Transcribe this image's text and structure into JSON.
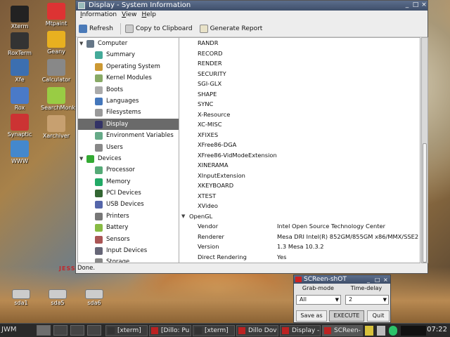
{
  "colors": {
    "selection": "#6a6a6a",
    "titlebar": "#3e4e6a",
    "taskbar": "#2a2a2a"
  },
  "desktop": {
    "icons": [
      {
        "label": "Xterm",
        "icon": "terminal-icon"
      },
      {
        "label": "Mtpaint",
        "icon": "paint-icon"
      },
      {
        "label": "RoxTerm",
        "icon": "terminal-icon"
      },
      {
        "label": "Geany",
        "icon": "editor-icon"
      },
      {
        "label": "Xfe",
        "icon": "file-manager-icon"
      },
      {
        "label": "Calculator",
        "icon": "calculator-icon"
      },
      {
        "label": "Rox",
        "icon": "file-manager-icon"
      },
      {
        "label": "SearchMonkey",
        "icon": "search-icon"
      },
      {
        "label": "Synaptic",
        "icon": "package-icon"
      },
      {
        "label": "Xarchiver",
        "icon": "archive-icon"
      },
      {
        "label": "WWW",
        "icon": "browser-icon"
      }
    ],
    "drives": [
      "sda1",
      "sda5",
      "sda6"
    ],
    "wallpaper_text": "JESSI"
  },
  "window": {
    "title": "Display - System Information",
    "menu": [
      "Information",
      "View",
      "Help"
    ],
    "toolbar": {
      "refresh": "Refresh",
      "copy": "Copy to Clipboard",
      "report": "Generate Report"
    },
    "status": "Done."
  },
  "tree": [
    {
      "label": "Computer",
      "icon": "computer-icon",
      "level": 0,
      "expander": "▼"
    },
    {
      "label": "Summary",
      "icon": "summary-icon",
      "level": 1
    },
    {
      "label": "Operating System",
      "icon": "os-icon",
      "level": 1
    },
    {
      "label": "Kernel Modules",
      "icon": "module-icon",
      "level": 1
    },
    {
      "label": "Boots",
      "icon": "boot-icon",
      "level": 1
    },
    {
      "label": "Languages",
      "icon": "language-icon",
      "level": 1
    },
    {
      "label": "Filesystems",
      "icon": "filesystem-icon",
      "level": 1
    },
    {
      "label": "Display",
      "icon": "display-icon",
      "level": 1,
      "selected": true
    },
    {
      "label": "Environment Variables",
      "icon": "env-icon",
      "level": 1
    },
    {
      "label": "Users",
      "icon": "users-icon",
      "level": 1
    },
    {
      "label": "Devices",
      "icon": "devices-icon",
      "level": 0,
      "expander": "▼"
    },
    {
      "label": "Processor",
      "icon": "processor-icon",
      "level": 1
    },
    {
      "label": "Memory",
      "icon": "memory-icon",
      "level": 1
    },
    {
      "label": "PCI Devices",
      "icon": "pci-icon",
      "level": 1
    },
    {
      "label": "USB Devices",
      "icon": "usb-icon",
      "level": 1
    },
    {
      "label": "Printers",
      "icon": "printer-icon",
      "level": 1
    },
    {
      "label": "Battery",
      "icon": "battery-icon",
      "level": 1
    },
    {
      "label": "Sensors",
      "icon": "sensor-icon",
      "level": 1
    },
    {
      "label": "Input Devices",
      "icon": "input-icon",
      "level": 1
    },
    {
      "label": "Storage",
      "icon": "storage-icon",
      "level": 1
    }
  ],
  "details": [
    {
      "key": "RANDR",
      "value": ""
    },
    {
      "key": "RECORD",
      "value": ""
    },
    {
      "key": "RENDER",
      "value": ""
    },
    {
      "key": "SECURITY",
      "value": ""
    },
    {
      "key": "SGI-GLX",
      "value": ""
    },
    {
      "key": "SHAPE",
      "value": ""
    },
    {
      "key": "SYNC",
      "value": ""
    },
    {
      "key": "X-Resource",
      "value": ""
    },
    {
      "key": "XC-MISC",
      "value": ""
    },
    {
      "key": "XFIXES",
      "value": ""
    },
    {
      "key": "XFree86-DGA",
      "value": ""
    },
    {
      "key": "XFree86-VidModeExtension",
      "value": ""
    },
    {
      "key": "XINERAMA",
      "value": ""
    },
    {
      "key": "XInputExtension",
      "value": ""
    },
    {
      "key": "XKEYBOARD",
      "value": ""
    },
    {
      "key": "XTEST",
      "value": ""
    },
    {
      "key": "XVideo",
      "value": ""
    },
    {
      "key": "OpenGL",
      "value": "",
      "section": true
    },
    {
      "key": "Vendor",
      "value": "Intel Open Source Technology Center"
    },
    {
      "key": "Renderer",
      "value": "Mesa DRI Intel(R) 852GM/855GM x86/MMX/SSE2"
    },
    {
      "key": "Version",
      "value": "1.3 Mesa 10.3.2"
    },
    {
      "key": "Direct Rendering",
      "value": "Yes"
    }
  ],
  "screenshot_dialog": {
    "title": "SCReen-shOT",
    "grab_mode_label": "Grab-mode",
    "delay_label": "Time-delay",
    "grab_mode_value": "All",
    "delay_value": "2",
    "save_label": "Save as",
    "execute_label": "EXECUTE",
    "quit_label": "Quit"
  },
  "taskbar": {
    "start": "JWM",
    "tasks": [
      {
        "label": "[xterm]",
        "icon": "terminal-icon"
      },
      {
        "label": "[Dillo: Pu",
        "icon": "dillo-icon"
      },
      {
        "label": "[xterm]",
        "icon": "terminal-icon"
      },
      {
        "label": "Dillo Dov",
        "icon": "dillo-icon"
      },
      {
        "label": "Display -",
        "icon": "display-icon"
      },
      {
        "label": "SCReen-",
        "icon": "screenshot-icon",
        "active": true
      }
    ],
    "clock": "07:22"
  }
}
